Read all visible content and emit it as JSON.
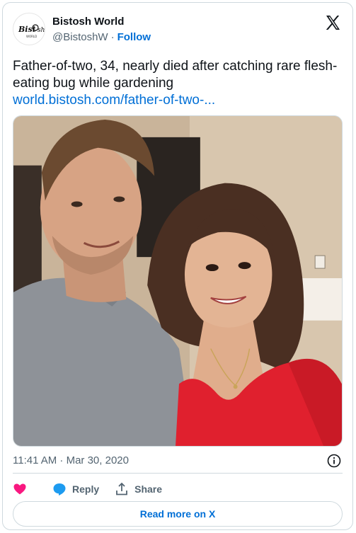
{
  "author": {
    "name": "Bistosh World",
    "handle": "@BistoshW",
    "follow_label": "Follow",
    "avatar_logo_text": "Bistosh World"
  },
  "tweet": {
    "text": "Father-of-two, 34, nearly died after catching rare flesh-eating bug while gardening",
    "link_text": "world.bistosh.com/father-of-two-..."
  },
  "photo": {
    "icon": "photo"
  },
  "timestamp": "11:41 AM · Mar 30, 2020",
  "actions": {
    "like_icon": "heart-icon",
    "reply_label": "Reply",
    "share_label": "Share"
  },
  "read_more_label": "Read more on X",
  "colors": {
    "accent": "#006fd6",
    "like": "#f91880",
    "reply_icon": "#1d9bf0",
    "muted": "#536471",
    "border": "#cfd9de"
  }
}
